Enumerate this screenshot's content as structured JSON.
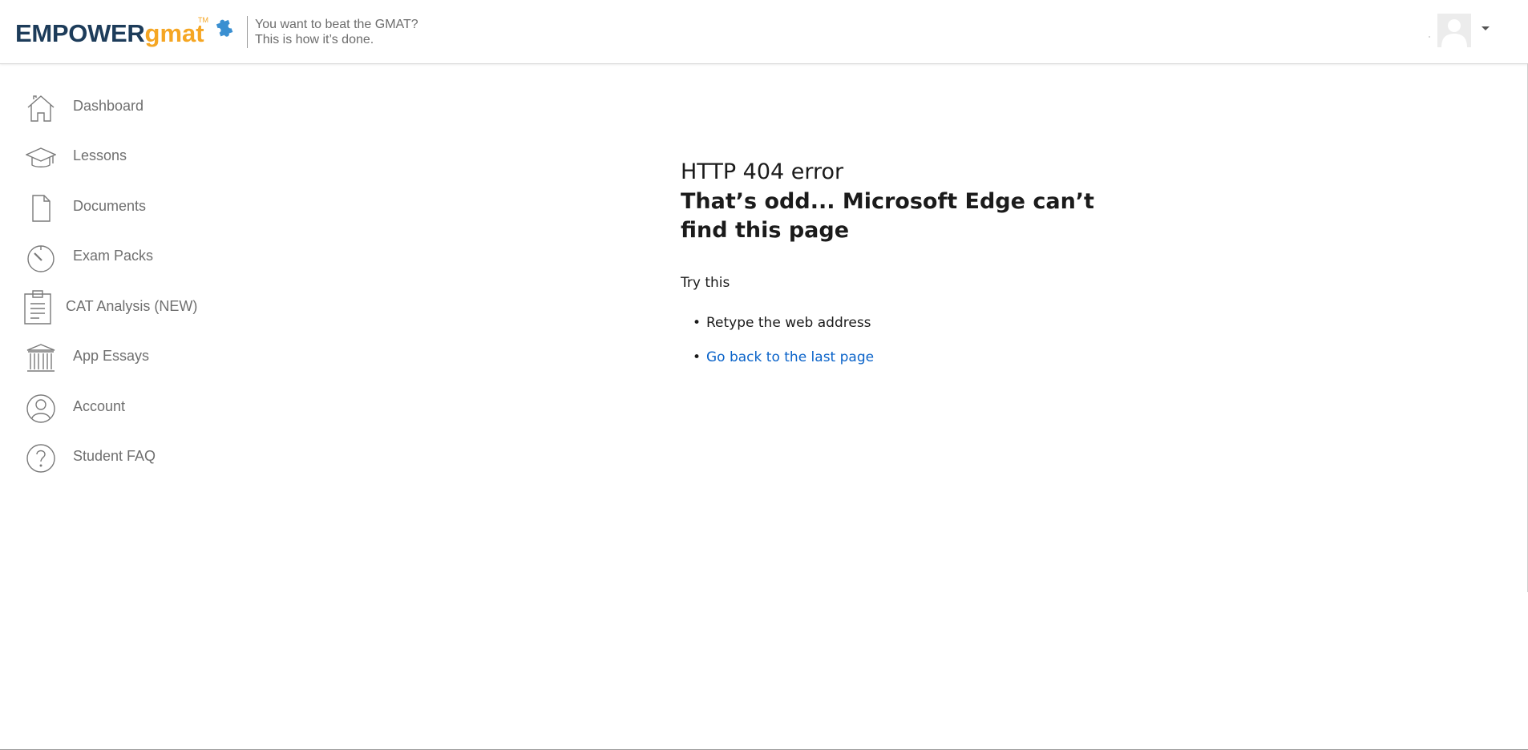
{
  "header": {
    "logo": {
      "brand_primary": "EMPOWER",
      "brand_secondary": "gmat",
      "trademark": "TM",
      "primary_color": "#1d3c5a",
      "secondary_color": "#f5a623"
    },
    "tagline_line1": "You want to beat the GMAT?",
    "tagline_line2": "This is how it’s done.",
    "user_menu": {
      "avatar": "avatar-placeholder",
      "caret": "chevron-down-icon"
    }
  },
  "sidebar": {
    "items": [
      {
        "label": "Dashboard",
        "icon": "house-icon"
      },
      {
        "label": "Lessons",
        "icon": "graduation-cap-icon"
      },
      {
        "label": "Documents",
        "icon": "document-icon"
      },
      {
        "label": "Exam Packs",
        "icon": "stopwatch-icon"
      },
      {
        "label": "CAT Analysis (NEW)",
        "icon": "clipboard-icon"
      },
      {
        "label": "App Essays",
        "icon": "building-columns-icon"
      },
      {
        "label": "Account",
        "icon": "user-circle-icon"
      },
      {
        "label": "Student FAQ",
        "icon": "question-circle-icon"
      }
    ]
  },
  "error": {
    "code": "HTTP 404 error",
    "title": "That’s odd... Microsoft Edge can’t find this page",
    "try_this": "Try this",
    "suggestions": [
      {
        "text": "Retype the web address",
        "is_link": false
      },
      {
        "text": "Go back to the last page",
        "is_link": true
      }
    ],
    "link_color": "#0a63c9"
  }
}
